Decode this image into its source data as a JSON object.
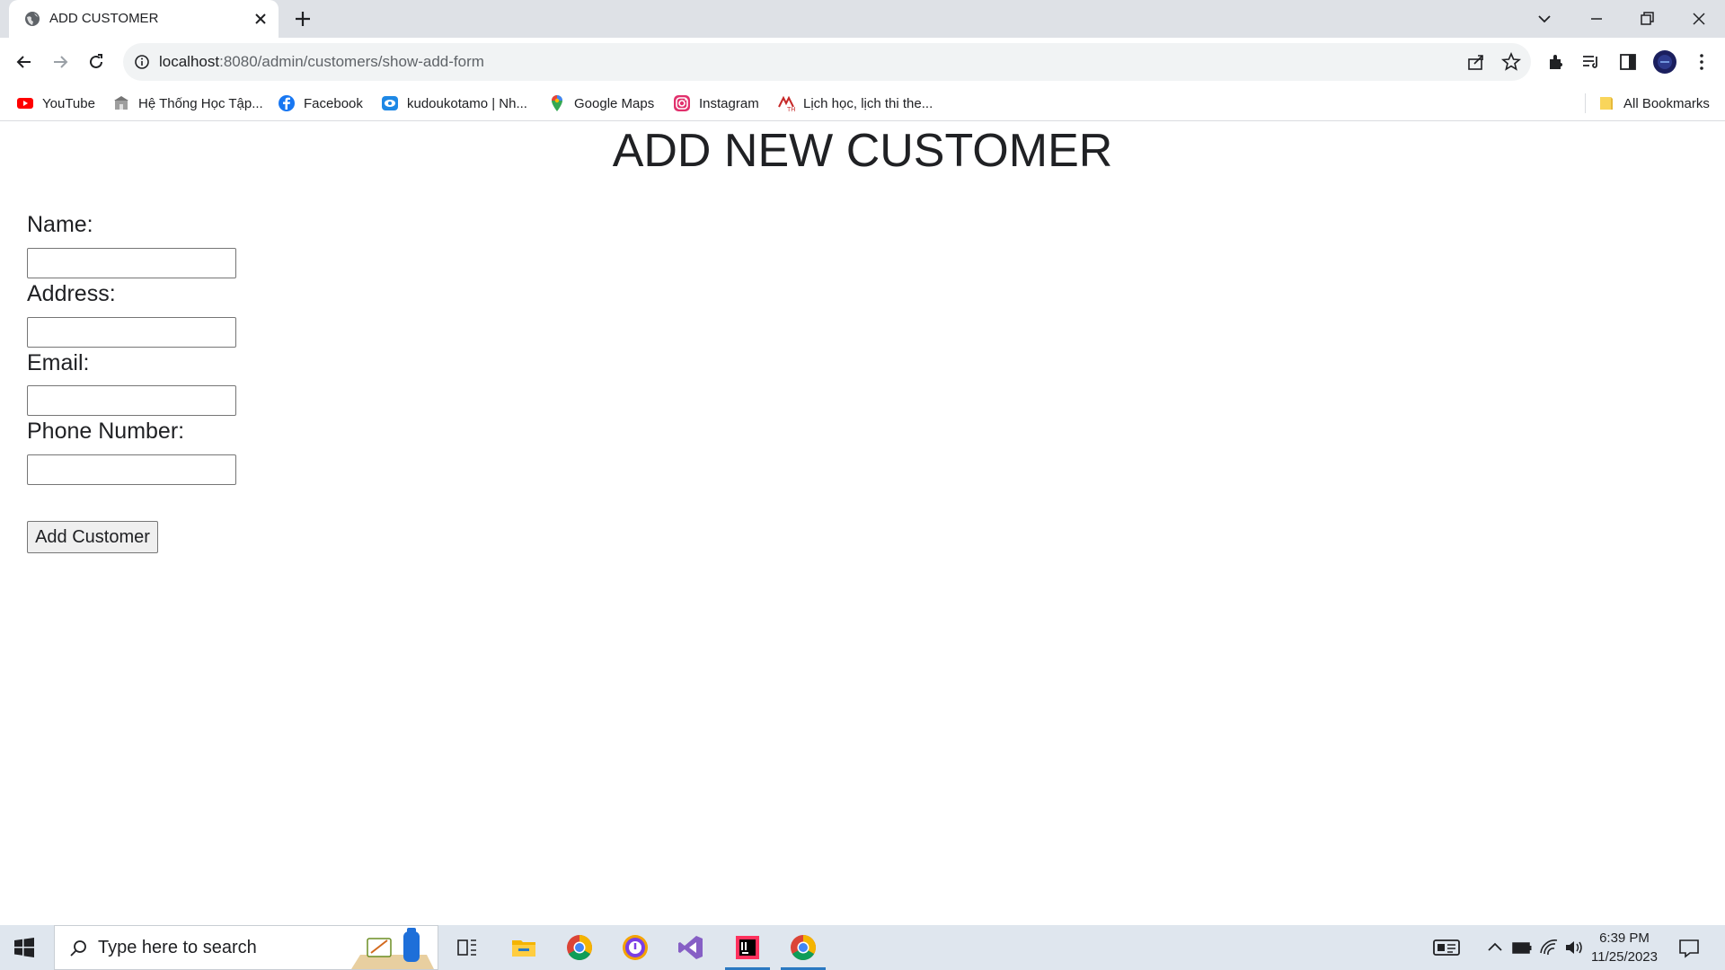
{
  "browser": {
    "tab": {
      "title": "ADD CUSTOMER"
    },
    "address_bar": {
      "host": "localhost",
      "path": ":8080/admin/customers/show-add-form"
    },
    "bookmarks": [
      {
        "label": "YouTube",
        "icon": "youtube-icon"
      },
      {
        "label": "Hệ Thống Học Tập...",
        "icon": "school-icon"
      },
      {
        "label": "Facebook",
        "icon": "facebook-icon"
      },
      {
        "label": "kudoukotamo | Nh...",
        "icon": "eye-icon"
      },
      {
        "label": "Google Maps",
        "icon": "map-pin-icon"
      },
      {
        "label": "Instagram",
        "icon": "instagram-icon"
      },
      {
        "label": "Lịch học, lịch thi the...",
        "icon": "university-icon"
      }
    ],
    "all_bookmarks_label": "All Bookmarks"
  },
  "page": {
    "title": "ADD NEW CUSTOMER",
    "form": {
      "fields": [
        {
          "label": "Name:",
          "value": ""
        },
        {
          "label": "Address:",
          "value": ""
        },
        {
          "label": "Email:",
          "value": ""
        },
        {
          "label": "Phone Number:",
          "value": ""
        }
      ],
      "submit_label": "Add Customer"
    }
  },
  "taskbar": {
    "search_placeholder": "Type here to search",
    "time": "6:39 PM",
    "date": "11/25/2023"
  },
  "colors": {
    "tab_strip": "#dee1e6",
    "omnibox": "#f1f3f4",
    "taskbar": "#dfe6ee",
    "taskbar_active": "#2b79c2"
  }
}
